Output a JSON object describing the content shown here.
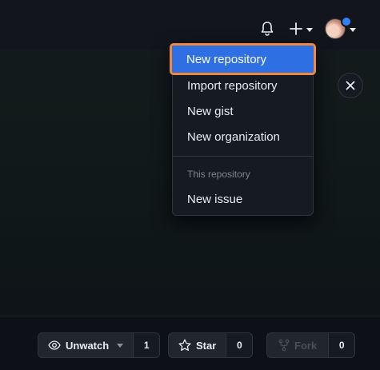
{
  "header": {
    "notifications_icon": "bell-icon",
    "create_icon": "plus-icon",
    "avatar_status": "notification-dot"
  },
  "create_menu": {
    "items": [
      {
        "label": "New repository"
      },
      {
        "label": "Import repository"
      },
      {
        "label": "New gist"
      },
      {
        "label": "New organization"
      }
    ],
    "section_label": "This repository",
    "section_items": [
      {
        "label": "New issue"
      }
    ]
  },
  "repo_actions": {
    "watch": {
      "label": "Unwatch",
      "count": "1"
    },
    "star": {
      "label": "Star",
      "count": "0"
    },
    "fork": {
      "label": "Fork",
      "count": "0",
      "disabled": true
    }
  },
  "colors": {
    "accent": "#2f6fe4",
    "highlight_outline": "#f0883e",
    "background": "#0d1117",
    "menu_background": "#161b22"
  }
}
